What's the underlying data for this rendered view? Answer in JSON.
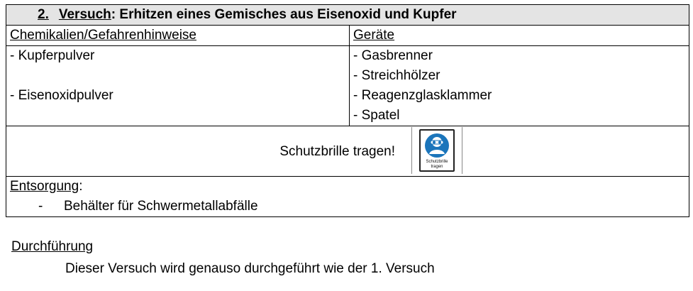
{
  "title": {
    "number": "2.",
    "label": "Versuch",
    "rest": ": Erhitzen eines Gemisches aus Eisenoxid und Kupfer"
  },
  "headers": {
    "chemicals": "Chemikalien/Gefahrenhinweise",
    "equipment": "Geräte"
  },
  "chemicals": [
    "- Kupferpulver",
    "",
    "- Eisenoxidpulver"
  ],
  "equipment": [
    "- Gasbrenner",
    "- Streichhölzer",
    "- Reagenzglasklammer",
    "- Spatel"
  ],
  "safety": {
    "text": "Schutzbrille tragen!",
    "sign_label": "Schutzbrille tragen",
    "sign_color": "#1b75bb",
    "sign_icon": "safety-goggles-icon"
  },
  "disposal": {
    "label": "Entsorgung",
    "colon": ":",
    "dash": "-",
    "item": "Behälter für Schwermetallabfälle"
  },
  "procedure": {
    "heading": "Durchführung",
    "text": "Dieser Versuch wird genauso durchgeführt wie der 1. Versuch"
  }
}
